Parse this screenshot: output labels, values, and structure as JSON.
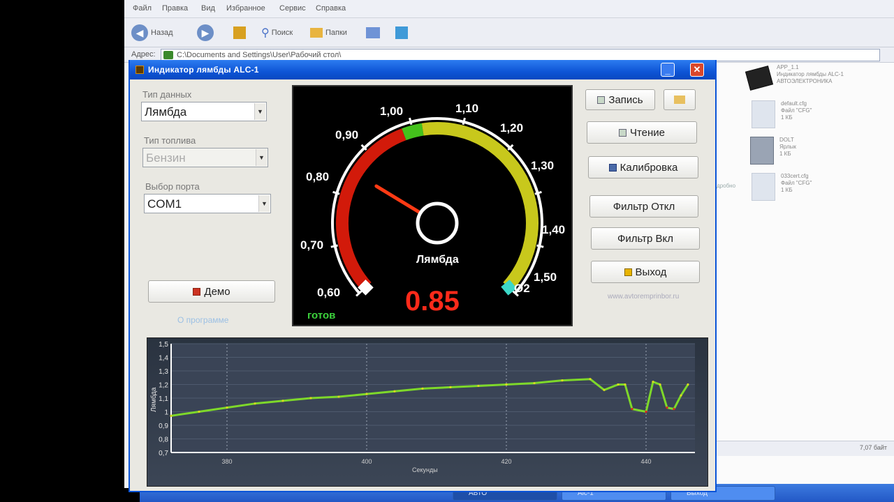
{
  "explorer": {
    "menu": [
      "Файл",
      "Правка",
      "Вид",
      "Избранное",
      "Сервис",
      "Справка"
    ],
    "toolbar": {
      "back": "Назад",
      "search": "Поиск",
      "folders": "Папки"
    },
    "address_label": "Адрес:",
    "address_path": "C:\\Documents and Settings\\User\\Рабочий стол\\",
    "files": [
      {
        "name": "APP_1.1",
        "desc": "Индикатор лямбды ALC-1",
        "sub": "АВТОЭЛЕКТРОНИКА"
      },
      {
        "name": "default.cfg",
        "desc": "Файл \"CFG\"",
        "sub": "1 КБ"
      },
      {
        "name": "DOLT",
        "desc": "Ярлык",
        "sub": "1 КБ"
      },
      {
        "name": "033cert.cfg",
        "desc": "Файл \"CFG\"",
        "sub": "1 КБ"
      }
    ],
    "side_label": "Подробно",
    "status_right": "7,07 байт"
  },
  "taskbar": {
    "items": [
      "АВТО",
      "Alc-1",
      "Выход"
    ]
  },
  "app": {
    "title": "Индикатор лямбды ALC-1",
    "data_type_label": "Тип данных",
    "data_type_value": "Лямбда",
    "fuel_type_label": "Тип топлива",
    "fuel_type_value": "Бензин",
    "port_label": "Выбор порта",
    "port_value": "COM1",
    "demo_button": "Демо",
    "about_link": "О программе",
    "buttons": {
      "record": "Запись",
      "read": "Чтение",
      "calibrate": "Калибровка",
      "filter_off": "Фильтр Откл",
      "filter_on": "Фильтр Вкл",
      "exit": "Выход"
    },
    "website": "www.avtoremprinbor.ru",
    "gauge": {
      "ticks": [
        "0,60",
        "0,70",
        "0,80",
        "0,90",
        "1,00",
        "1,10",
        "1,20",
        "1,30",
        "1,40",
        "1,50"
      ],
      "label": "Лямбда",
      "o2_label": "O2",
      "value": "0.85",
      "status": "готов",
      "range": [
        0.6,
        1.5
      ],
      "needle_value": 0.85,
      "colors": {
        "red": "#d21a0a",
        "green": "#44c21c",
        "yellow": "#c8c81c",
        "needle": "#ff3a14",
        "value": "#ff2a1a",
        "status": "#3cd23c"
      }
    },
    "chart": {
      "ylabel": "Лямбда",
      "xlabel": "Секунды",
      "yticks": [
        "1,5",
        "1,4",
        "1,3",
        "1,2",
        "1,1",
        "1",
        "0,9",
        "0,8",
        "0,7"
      ],
      "xticks": [
        "380",
        "400",
        "420",
        "440"
      ]
    }
  },
  "chart_data": {
    "type": "line",
    "title": "",
    "xlabel": "Секунды",
    "ylabel": "Лямбда",
    "xlim": [
      372,
      447
    ],
    "ylim": [
      0.7,
      1.5
    ],
    "grid": true,
    "series": [
      {
        "color": "#7ed82a",
        "x": [
          372,
          376,
          380,
          384,
          388,
          392,
          396,
          400,
          404,
          408,
          412,
          416,
          420,
          424,
          428,
          432,
          434,
          436,
          437,
          438,
          440,
          441,
          442,
          443,
          444,
          445,
          446
        ],
        "values": [
          0.97,
          1.0,
          1.03,
          1.06,
          1.08,
          1.1,
          1.11,
          1.13,
          1.15,
          1.17,
          1.18,
          1.19,
          1.2,
          1.21,
          1.23,
          1.24,
          1.16,
          1.2,
          1.2,
          1.02,
          1.0,
          1.22,
          1.2,
          1.03,
          1.02,
          1.12,
          1.2
        ]
      }
    ]
  }
}
